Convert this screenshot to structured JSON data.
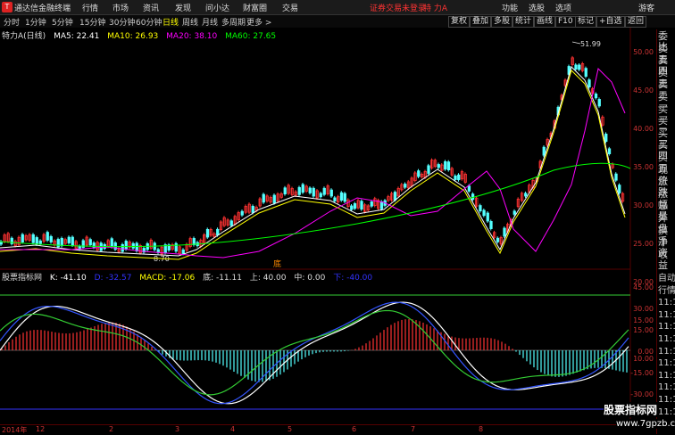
{
  "app": {
    "title": "通达信金融终端",
    "logo": "T"
  },
  "menus": [
    "行情",
    "市场",
    "资讯",
    "发现",
    "问小达",
    "财富圈",
    "交易"
  ],
  "login_warn": "证券交易未登录",
  "stock_title": "特 力A",
  "right_menus": [
    "功能",
    "选股",
    "选项",
    "游客"
  ],
  "period_tabs": [
    "分时",
    "1分钟",
    "5分钟",
    "15分钟",
    "30分钟",
    "60分钟",
    "日线",
    "周线",
    "月线",
    "多周期",
    "更多 >"
  ],
  "active_period": "日线",
  "tools": [
    "复权",
    "叠加",
    "多股",
    "统计",
    "画线",
    "F10",
    "标记",
    "+自选",
    "返回"
  ],
  "legend_main": {
    "name": "特力A(日线)",
    "ma5": "MA5: 22.41",
    "ma10": "MA10: 26.93",
    "ma20": "MA20: 38.10",
    "ma60": "MA60: 27.65"
  },
  "legend_ind": {
    "name": "股票指标网",
    "k": "K: -41.10",
    "d": "D: -32.57",
    "macd": "MACD: -17.06",
    "di": "底: -11.11",
    "shang": "上: 40.00",
    "zhong": "中: 0.00",
    "xia": "下: -40.00"
  },
  "price_ticks": [
    "50.00",
    "45.00",
    "40.00",
    "35.00",
    "30.00",
    "25.00",
    "20.00",
    "15.00",
    "10.00"
  ],
  "ind_ticks": [
    "45.00",
    "30.00",
    "15.00",
    "0.00",
    "-15.00",
    "-30.00"
  ],
  "high_label": "51.99",
  "low_label": "8.70",
  "bottom_mark": "底",
  "date_labels": [
    "2014年",
    "12",
    "2",
    "3",
    "4",
    "5",
    "6",
    "7",
    "8"
  ],
  "right_panel": [
    "委比",
    "卖五",
    "卖四",
    "卖三",
    "卖二",
    "卖一",
    "买一",
    "买二",
    "买三",
    "买四",
    "买五",
    "现价",
    "涨跌",
    "涨幅",
    "总量",
    "外盘",
    "换手",
    "净资",
    "收益"
  ],
  "right_panel2": [
    "自动",
    "行情",
    "11:1",
    "11:1",
    "11:1",
    "11:1",
    "11:1",
    "11:1",
    "11:1",
    "11:1",
    "11:1",
    "11:1",
    "11:1"
  ],
  "watermark": "股票指标网",
  "watermark_url": "www.7gpzb.com",
  "colors": {
    "up": "#ff3232",
    "down": "#54ffff",
    "ma5": "#ffffff",
    "ma10": "#ffff00",
    "ma20": "#ff00ff",
    "ma60": "#00ff00",
    "axis": "#cc3333"
  }
}
